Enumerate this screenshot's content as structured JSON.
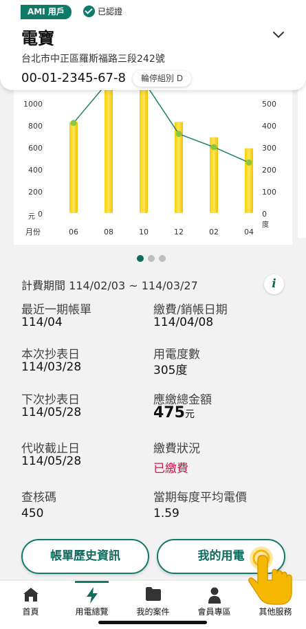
{
  "header": {
    "ami_badge": "AMI 用戶",
    "verified_label": "已認證",
    "account_name": "電寶",
    "address": "台北市中正區羅斯福路三段242號",
    "account_number": "00-01-2345-67-8",
    "group_chip": "輪停組別 D"
  },
  "chart_data": {
    "type": "bar+line",
    "categories": [
      "06",
      "08",
      "10",
      "12",
      "02",
      "04"
    ],
    "xlabel": "月份",
    "left_axis": {
      "unit_label": "元",
      "ticks": [
        "0",
        "200",
        "400",
        "600",
        "800",
        "1000"
      ],
      "ylim": [
        0,
        1000
      ]
    },
    "right_axis": {
      "unit_label": "度",
      "ticks": [
        "0",
        "100",
        "200",
        "300",
        "400",
        "500"
      ],
      "ylim": [
        0,
        500
      ]
    },
    "series": [
      {
        "values": [
          830,
          1200,
          1200,
          830,
          690,
          590
        ],
        "axis": "left",
        "color": "#f2c200"
      },
      {
        "values": [
          410,
          600,
          600,
          360,
          300,
          230
        ],
        "axis": "right",
        "color": "#1f7f6e"
      }
    ]
  },
  "pagination": {
    "pages": 3,
    "active": 0
  },
  "billing": {
    "period": "計費期間 114/02/03 ~ 114/03/27",
    "fields": [
      {
        "label": "最近一期帳單",
        "value": "114/04"
      },
      {
        "label": "繳費/銷帳日期",
        "value": "114/04/08"
      },
      {
        "label": "本次抄表日",
        "value": "114/03/28"
      },
      {
        "label": "用電度數",
        "value": "305度"
      },
      {
        "label": "下次抄表日",
        "value": "114/05/28"
      },
      {
        "label": "應繳總金額",
        "value": "475",
        "unit": "元"
      },
      {
        "label": "代收截止日",
        "value": "114/05/28"
      },
      {
        "label": "繳費狀況",
        "value": "已繳費"
      },
      {
        "label": "查核碼",
        "value": "450"
      },
      {
        "label": "當期每度平均電價",
        "value": "1.59"
      }
    ]
  },
  "buttons": {
    "history": "帳單歷史資訊",
    "my_electricity": "我的用電"
  },
  "nav": [
    {
      "label": "首頁",
      "icon": "home-icon"
    },
    {
      "label": "用電總覽",
      "icon": "lightning-icon"
    },
    {
      "label": "我的案件",
      "icon": "folder-icon"
    },
    {
      "label": "會員專區",
      "icon": "person-icon"
    },
    {
      "label": "其他服務",
      "icon": "grid-icon"
    }
  ],
  "colors": {
    "primary": "#0f7a68",
    "bar": "#f2c200",
    "paid": "#d3174a"
  }
}
